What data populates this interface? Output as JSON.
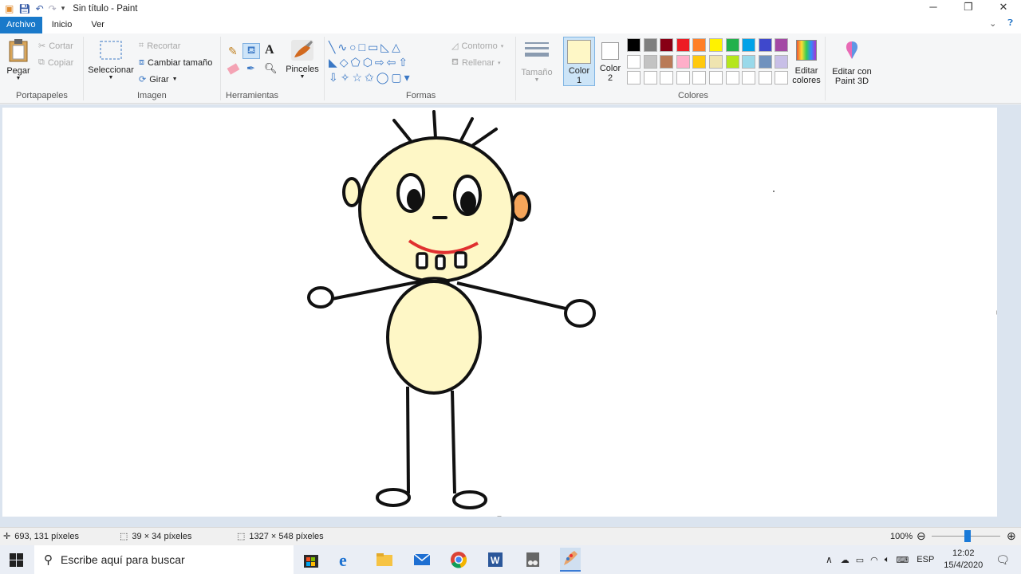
{
  "window": {
    "title": "Sin título - Paint",
    "minimize": "─",
    "maximize": "❐",
    "close": "✕"
  },
  "menu": {
    "file": "Archivo",
    "home": "Inicio",
    "view": "Ver"
  },
  "ribbon": {
    "clipboard": {
      "paste": "Pegar",
      "cut": "Cortar",
      "copy": "Copiar",
      "label": "Portapapeles"
    },
    "image": {
      "select": "Seleccionar",
      "crop": "Recortar",
      "resize": "Cambiar tamaño",
      "rotate": "Girar",
      "label": "Imagen"
    },
    "tools": {
      "label": "Herramientas"
    },
    "brushes": {
      "label": "Pinceles"
    },
    "shapes": {
      "outline": "Contorno",
      "fill": "Rellenar",
      "label": "Formas"
    },
    "size": {
      "label": "Tamaño"
    },
    "color1": {
      "label": "Color",
      "num": "1",
      "value": "#fef7c6"
    },
    "color2": {
      "label": "Color",
      "num": "2",
      "value": "#ffffff"
    },
    "colors": {
      "label": "Colores",
      "row1": [
        "#000000",
        "#7f7f7f",
        "#880015",
        "#ed1c24",
        "#ff7f27",
        "#fff200",
        "#22b14c",
        "#00a2e8",
        "#3f48cc",
        "#a349a4"
      ],
      "row2": [
        "#ffffff",
        "#c3c3c3",
        "#b97a57",
        "#ffaec9",
        "#ffc90e",
        "#efe4b0",
        "#b5e61d",
        "#99d9ea",
        "#7092be",
        "#c8bfe7"
      ]
    },
    "edit_colors": {
      "line1": "Editar",
      "line2": "colores"
    },
    "paint3d": {
      "line1": "Editar con",
      "line2": "Paint 3D"
    }
  },
  "status": {
    "cursor": "693, 131 píxeles",
    "selection": "39 × 34 píxeles",
    "canvas_size": "1327 × 548 píxeles",
    "zoom": "100%"
  },
  "taskbar": {
    "search_placeholder": "Escribe aquí para buscar",
    "lang": "ESP",
    "time": "12:02",
    "date": "15/4/2020"
  }
}
